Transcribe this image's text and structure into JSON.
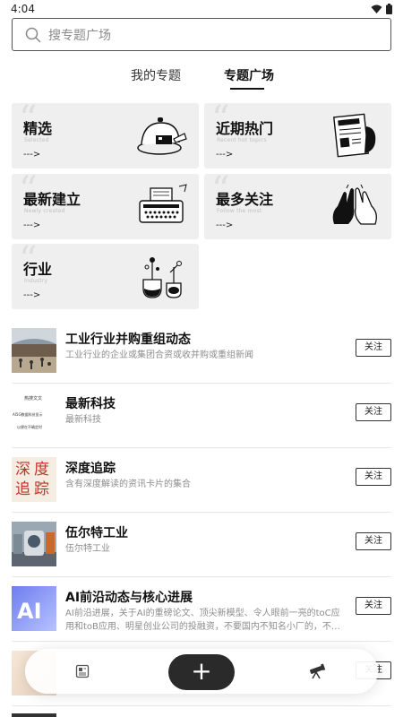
{
  "status": {
    "time": "4:04"
  },
  "search": {
    "placeholder": "搜专题广场"
  },
  "tabs": [
    {
      "label": "我的专题",
      "active": false
    },
    {
      "label": "专题广场",
      "active": true
    }
  ],
  "categories": [
    {
      "title": "精选",
      "subtitle": "Selected",
      "arrow": "--->",
      "icon": "cloche-icon"
    },
    {
      "title": "近期热门",
      "subtitle": "Recent hot topics",
      "arrow": "--->",
      "icon": "newspaper-icon"
    },
    {
      "title": "最新建立",
      "subtitle": "Newly created",
      "arrow": "--->",
      "icon": "typewriter-icon"
    },
    {
      "title": "最多关注",
      "subtitle": "Follow the most",
      "arrow": "--->",
      "icon": "high-five-icon"
    },
    {
      "title": "行业",
      "subtitle": "Industry",
      "arrow": "--->",
      "icon": "lab-flasks-icon"
    }
  ],
  "topics": [
    {
      "title": "工业行业并购重组动态",
      "desc": "工业行业的企业或集团合资或收并购或重组新闻",
      "follow": "关注"
    },
    {
      "title": "最新科技",
      "desc": "最新科技",
      "follow": "关注",
      "thumb_text": [
        "热搜文文",
        "AI5G数据科技显示",
        "以便在不确定时"
      ]
    },
    {
      "title": "深度追踪",
      "desc": "含有深度解读的资讯卡片的集合",
      "follow": "关注",
      "thumb_text": [
        "深度",
        "追踪"
      ]
    },
    {
      "title": "伍尔特工业",
      "desc": "伍尔特工业",
      "follow": "关注"
    },
    {
      "title": "AI前沿动态与核心进展",
      "desc": "AI前沿进展，关于AI的重磅论文、顶尖新模型、令人眼前一亮的toC应用和toB应用、明星创业公司的投融资，不要国内不知名小厂的，不…",
      "follow": "关注",
      "thumb_text": [
        "AI"
      ]
    },
    {
      "title": "",
      "desc": "",
      "follow": "关注"
    }
  ],
  "bottom_bar": {
    "add_label": "+"
  },
  "colors": {
    "accent": "#2a2a2a",
    "card_bg": "#efefef"
  }
}
